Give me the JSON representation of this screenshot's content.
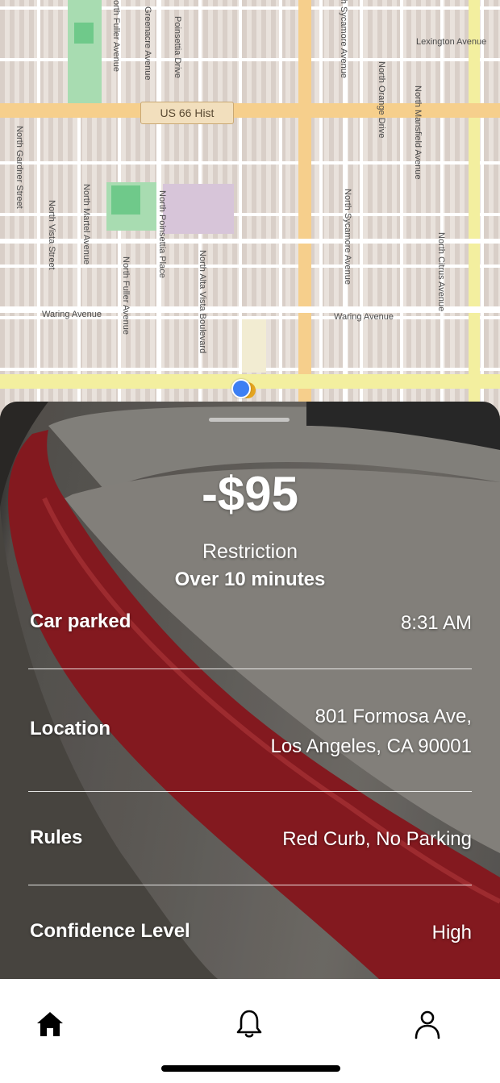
{
  "map": {
    "shield_label": "US 66 Hist",
    "street_labels": {
      "north_fuller_top": "North Fuller Avenue",
      "greenacre": "Greenacre Avenue",
      "poinsettia_drive": "Poinsettia Drive",
      "sycamore_top": "North Sycamore Avenue",
      "lexington": "Lexington Avenue",
      "north_orange": "North Orange Drive",
      "north_mansfield": "North Mansfield Avenue",
      "north_gardner": "North Gardner Street",
      "north_vista": "North Vista Street",
      "north_martel": "North Martel Avenue",
      "north_fuller_bottom": "North Fuller Avenue",
      "north_poinsettia_place": "North Poinsettia Place",
      "north_alta_vista": "North Alta Vista Boulevard",
      "north_sycamore": "North Sycamore Avenue",
      "north_citrus": "North Citrus Avenue",
      "waring_left": "Waring Avenue",
      "waring_right": "Waring Avenue"
    }
  },
  "ticket": {
    "fine_amount": "-$95",
    "restriction_label": "Restriction",
    "restriction_value": "Over 10 minutes",
    "rows": [
      {
        "label": "Car parked",
        "value": "8:31 AM"
      },
      {
        "label": "Location",
        "value_line1": "801 Formosa Ave,",
        "value_line2": "Los Angeles, CA 90001"
      },
      {
        "label": "Rules",
        "value": "Red Curb, No Parking"
      },
      {
        "label": "Confidence Level",
        "value": "High"
      }
    ]
  },
  "tabbar": {
    "icons": [
      "home-icon",
      "bell-icon",
      "profile-icon"
    ],
    "active_color": "#000000"
  },
  "colors": {
    "curb_red": "#8f1c22",
    "sidewalk": "#8a8680",
    "location_dot": "#3d7ff3",
    "highway": "#f6cf8c"
  }
}
